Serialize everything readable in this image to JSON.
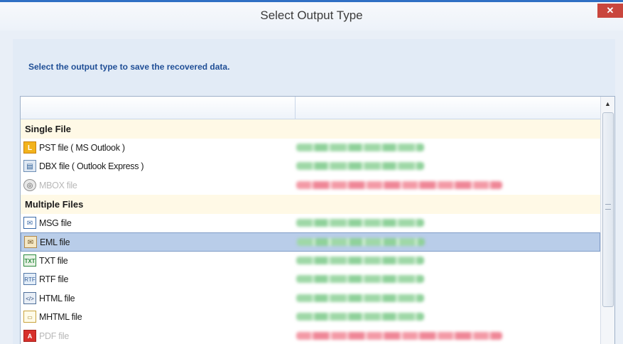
{
  "window": {
    "title": "Select Output Type",
    "close_label": "✕"
  },
  "instruction": "Select the output type to save the recovered data.",
  "groups": {
    "single": "Single File",
    "multiple": "Multiple Files"
  },
  "items": [
    {
      "label": "PST file ( MS Outlook )",
      "icon": "pst-icon",
      "glyph": "L",
      "status": "ok",
      "enabled": true
    },
    {
      "label": "DBX file ( Outlook Express )",
      "icon": "dbx-icon",
      "glyph": "▤",
      "status": "ok",
      "enabled": true
    },
    {
      "label": "MBOX file",
      "icon": "mbox-icon",
      "glyph": "◎",
      "status": "bad",
      "enabled": false
    },
    {
      "label": "MSG file",
      "icon": "msg-icon",
      "glyph": "✉",
      "status": "ok",
      "enabled": true
    },
    {
      "label": "EML file",
      "icon": "eml-icon",
      "glyph": "✉",
      "status": "ok",
      "enabled": true,
      "selected": true
    },
    {
      "label": "TXT file",
      "icon": "txt-icon",
      "glyph": "TXT",
      "status": "ok",
      "enabled": true
    },
    {
      "label": "RTF file",
      "icon": "rtf-icon",
      "glyph": "RTF",
      "status": "ok",
      "enabled": true
    },
    {
      "label": "HTML file",
      "icon": "html-icon",
      "glyph": "</>",
      "status": "ok",
      "enabled": true
    },
    {
      "label": "MHTML file",
      "icon": "mhtml-icon",
      "glyph": "▭",
      "status": "ok",
      "enabled": true
    },
    {
      "label": "PDF file",
      "icon": "pdf-icon",
      "glyph": "A",
      "status": "bad",
      "enabled": false
    }
  ],
  "colors": {
    "accent": "#2f6fc4",
    "close": "#c9463d",
    "selection": "#b9cde9",
    "group_background": "#fff9e6",
    "status_ok": "#9fd8a7",
    "status_bad": "#f39aa6"
  }
}
